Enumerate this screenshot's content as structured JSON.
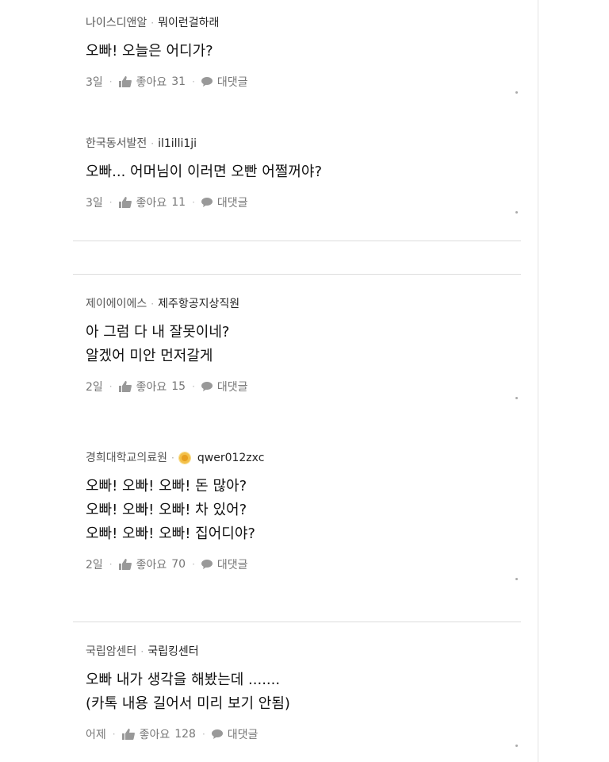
{
  "like_label": "좋아요",
  "reply_label": "대댓글",
  "comments": [
    {
      "board": "나이스디앤알",
      "nickname": "뭐이런걸하래",
      "lines": [
        "오빠! 오늘은 어디가?"
      ],
      "time": "3일",
      "likes": "31"
    },
    {
      "board": "한국동서발전",
      "nickname": "il1illi1ji",
      "lines": [
        "오빠... 어머님이 이러면 오빤 어쩔꺼야?"
      ],
      "time": "3일",
      "likes": "11"
    },
    {
      "board": "제이에이에스",
      "nickname": "제주항공지상직원",
      "lines": [
        "아 그럼 다 내 잘못이네?",
        "알겠어 미안 먼저갈게"
      ],
      "time": "2일",
      "likes": "15"
    },
    {
      "board": "경희대학교의료원",
      "nickname": "qwer012zxc",
      "lines": [
        "오빠! 오빠! 오빠! 돈 많아?",
        "오빠! 오빠! 오빠! 차 있어?",
        "오빠! 오빠! 오빠! 집어디야?"
      ],
      "time": "2일",
      "likes": "70"
    },
    {
      "board": "국립암센터",
      "nickname": "국립킹센터",
      "lines": [
        "오빠 내가 생각을 해봤는데 .......",
        "(카톡 내용 길어서 미리 보기 안됨)"
      ],
      "time": "어제",
      "likes": "128"
    }
  ]
}
